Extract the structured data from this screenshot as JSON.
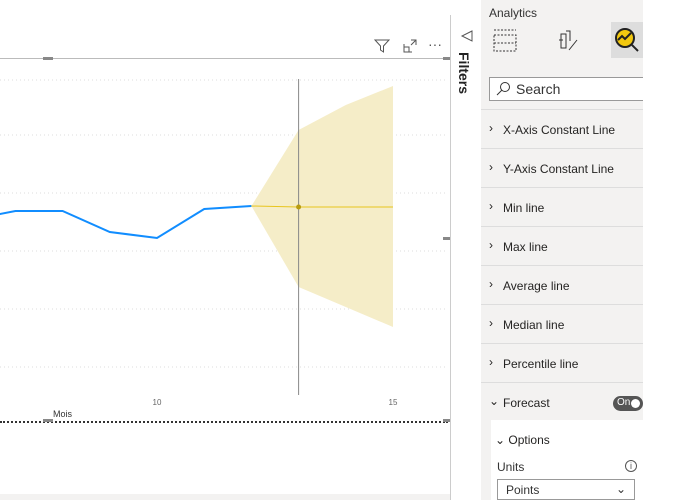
{
  "visual": {
    "header_icons": [
      "filter-icon",
      "focus-mode-icon",
      "more-options-icon"
    ],
    "more_label": "···"
  },
  "chart_data": {
    "type": "line",
    "xlabel": "Mois",
    "ylabel": "",
    "x_ticks": [
      "10",
      "15"
    ],
    "xlim": [
      6.67,
      16.1
    ],
    "ylim": [
      0,
      350
    ],
    "grid": true,
    "series": [
      {
        "x": [
          6.67,
          7,
          8,
          9,
          10,
          11,
          12
        ],
        "values": [
          186,
          189,
          189,
          168,
          162,
          191,
          194
        ],
        "color": "#118dff"
      }
    ],
    "forecast": {
      "x": [
        12,
        13,
        14,
        15
      ],
      "values": [
        194,
        193,
        193,
        193
      ],
      "upper": [
        194,
        270,
        295,
        314
      ],
      "lower": [
        194,
        113,
        93,
        73
      ],
      "color": "#e8c51e",
      "band_color": "#f5edc8"
    },
    "reference_x": 13
  },
  "filters": {
    "label": "Filters"
  },
  "analytics": {
    "title": "Analytics",
    "search_placeholder": "Search",
    "sections": [
      "X-Axis Constant Line",
      "Y-Axis Constant Line",
      "Min line",
      "Max line",
      "Average line",
      "Median line",
      "Percentile line"
    ],
    "forecast": {
      "label": "Forecast",
      "toggle": "On"
    },
    "options": {
      "label": "Options",
      "units_label": "Units",
      "units_value": "Points"
    }
  }
}
